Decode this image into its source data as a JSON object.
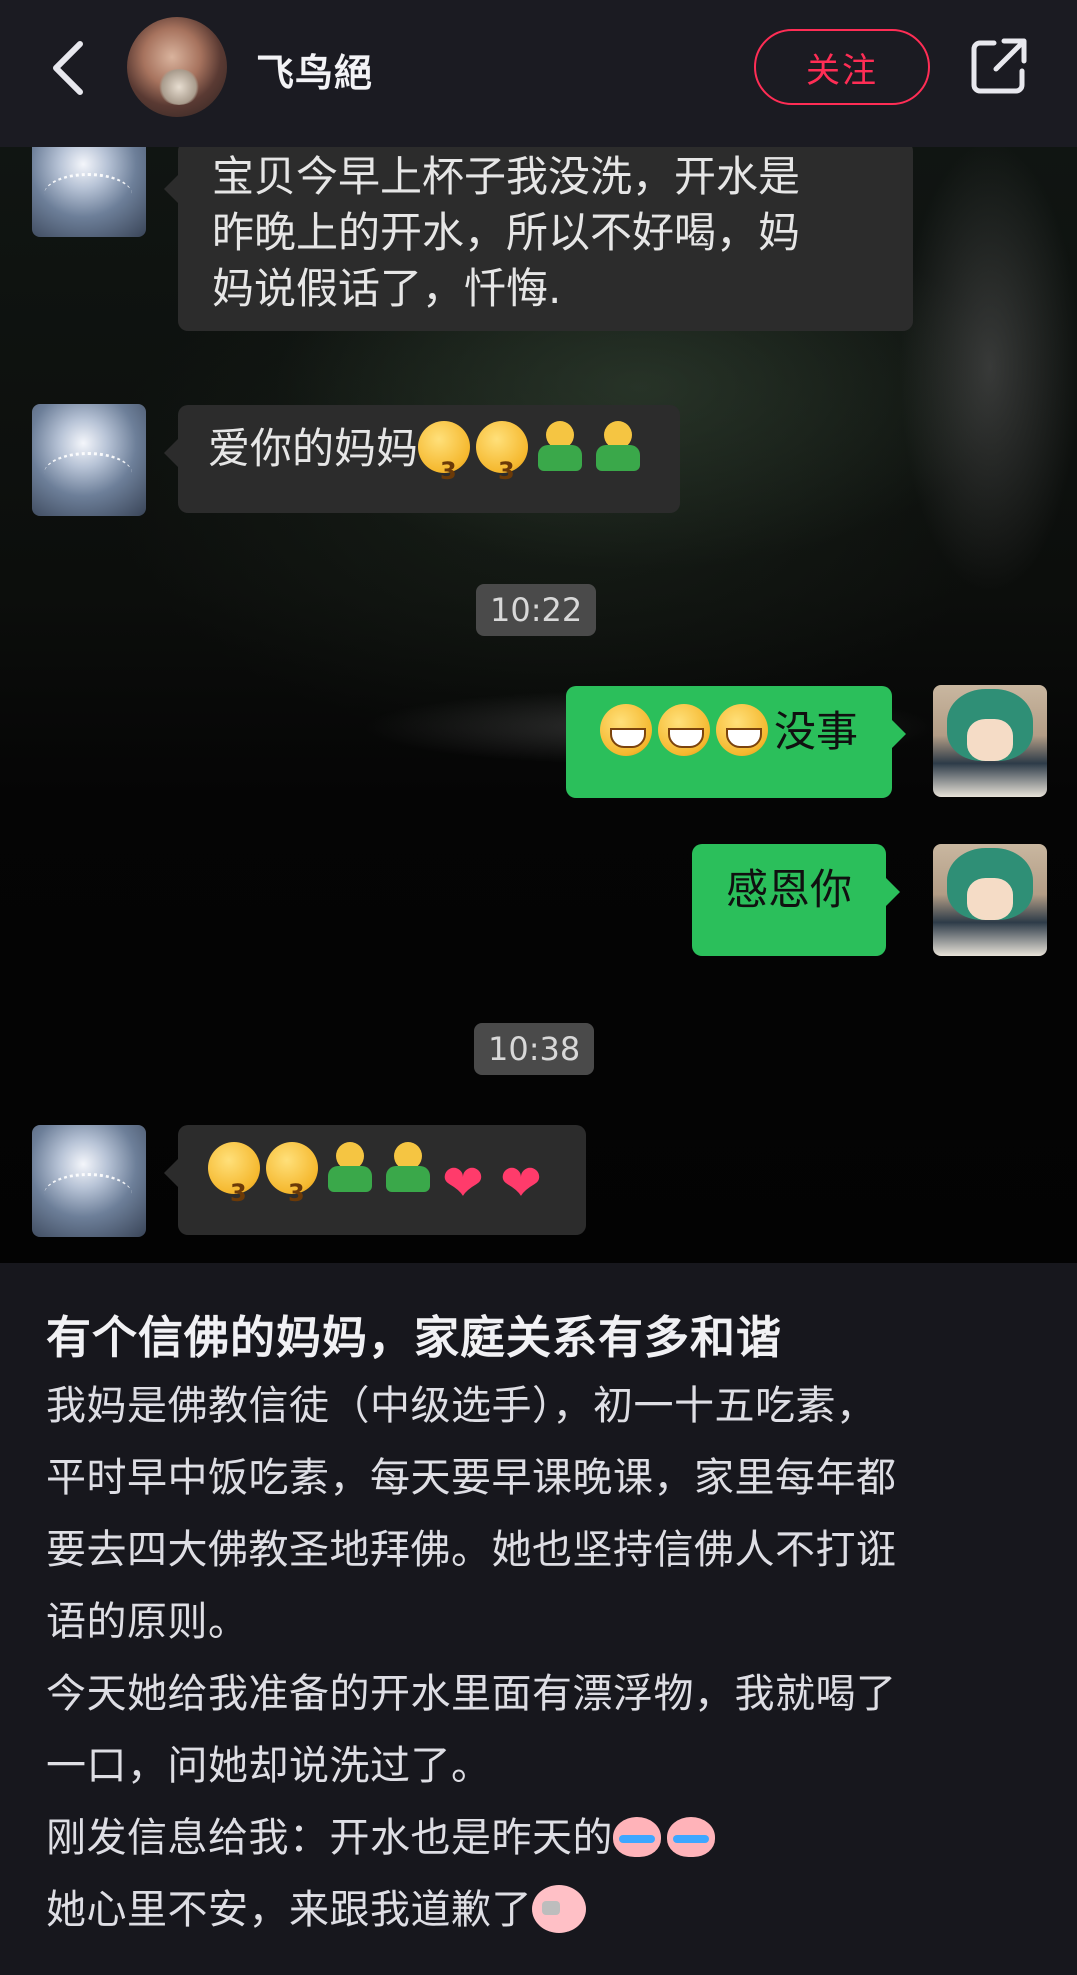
{
  "header": {
    "username": "飞鸟絕",
    "follow_label": "关注",
    "icons": {
      "back": "chevron-left-icon",
      "share": "share-external-icon"
    }
  },
  "chat": {
    "messages": [
      {
        "side": "in",
        "text": "宝贝今早上杯子我没洗，开水是昨晚上的开水，所以不好喝，妈妈说假话了，忏悔.",
        "lines": [
          "宝贝今早上杯子我没洗，开水是",
          "昨晚上的开水，所以不好喝，妈",
          "妈说假话了，忏悔."
        ]
      },
      {
        "side": "in",
        "text": "爱你的妈妈",
        "emojis": [
          "kissing-face",
          "kissing-face",
          "hugging-person",
          "hugging-person"
        ]
      },
      {
        "type": "timestamp",
        "text": "10:22"
      },
      {
        "side": "out",
        "text": "没事",
        "emojis": [
          "grinning-face",
          "grinning-face",
          "grinning-face"
        ]
      },
      {
        "side": "out",
        "text": "感恩你"
      },
      {
        "type": "timestamp",
        "text": "10:38"
      },
      {
        "side": "in",
        "text": "",
        "emojis": [
          "kissing-face",
          "kissing-face",
          "hugging-person",
          "hugging-person",
          "heart",
          "heart"
        ]
      }
    ]
  },
  "post": {
    "title": "有个信佛的妈妈，家庭关系有多和谐",
    "lines": [
      "我妈是佛教信徒（中级选手），初一十五吃素，",
      "平时早中饭吃素，每天要早课晚课，家里每年都",
      "要去四大佛教圣地拜佛。她也坚持信佛人不打诳",
      "语的原则。",
      "今天她给我准备的开水里面有漂浮物，我就喝了",
      "一口，问她却说洗过了。",
      "刚发信息给我：开水也是昨天的",
      "她心里不安，来跟我道歉了"
    ],
    "inline_emojis": {
      "line7": [
        "crying-face",
        "crying-face"
      ],
      "line8": [
        "thinking-face"
      ]
    }
  },
  "colors": {
    "follow": "#ff2d55",
    "outgoing_bubble": "#2bbf5b",
    "incoming_bubble": "#2c2c2c",
    "background": "#17171d"
  }
}
